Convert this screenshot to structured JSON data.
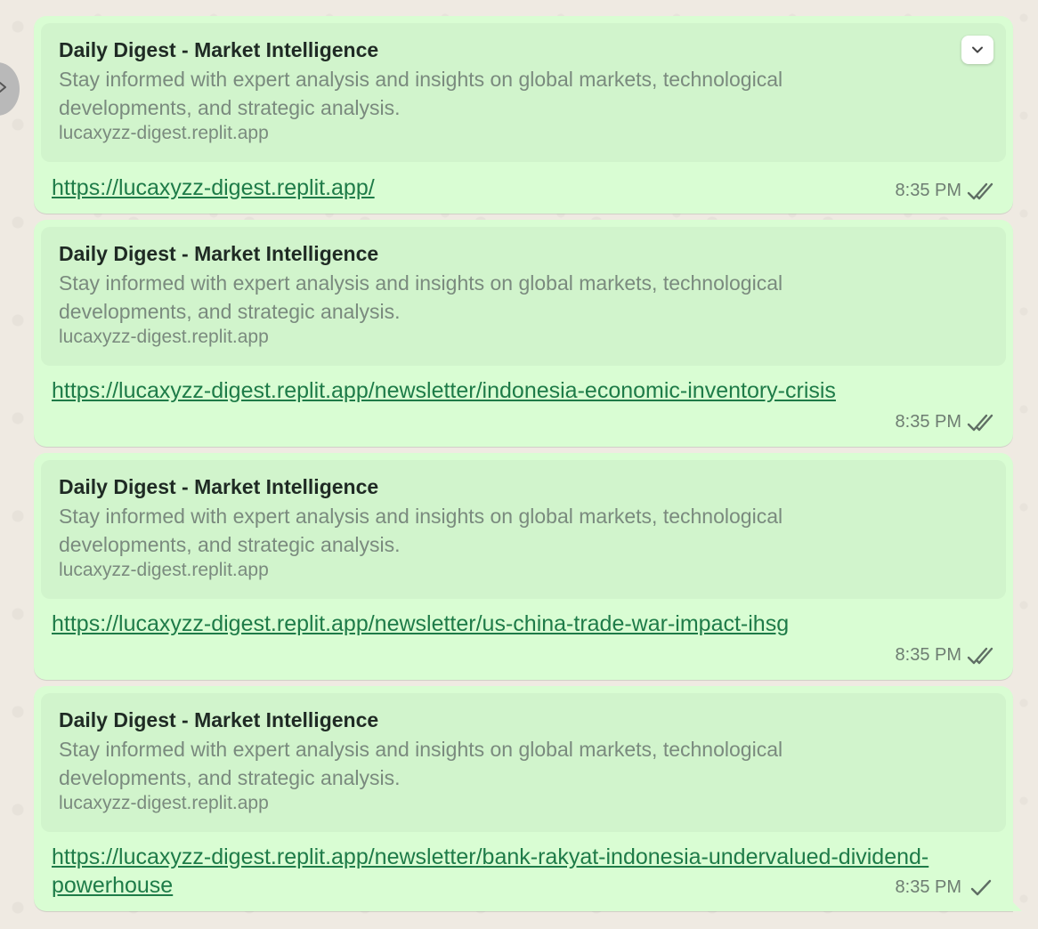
{
  "messages": [
    {
      "preview": {
        "title": "Daily Digest - Market Intelligence",
        "description": "Stay informed with expert analysis and insights on global markets, technological developments, and strategic analysis.",
        "domain": "lucaxyzz-digest.replit.app"
      },
      "link": "https://lucaxyzz-digest.replit.app/",
      "time": "8:35 PM",
      "status_icon": "double-check-icon"
    },
    {
      "preview": {
        "title": "Daily Digest - Market Intelligence",
        "description": "Stay informed with expert analysis and insights on global markets, technological developments, and strategic analysis.",
        "domain": "lucaxyzz-digest.replit.app"
      },
      "link": "https://lucaxyzz-digest.replit.app/newsletter/indonesia-economic-inventory-crisis",
      "time": "8:35 PM",
      "status_icon": "double-check-icon"
    },
    {
      "preview": {
        "title": "Daily Digest - Market Intelligence",
        "description": "Stay informed with expert analysis and insights on global markets, technological developments, and strategic analysis.",
        "domain": "lucaxyzz-digest.replit.app"
      },
      "link": "https://lucaxyzz-digest.replit.app/newsletter/us-china-trade-war-impact-ihsg",
      "time": "8:35 PM",
      "status_icon": "double-check-icon"
    },
    {
      "preview": {
        "title": "Daily Digest - Market Intelligence",
        "description": "Stay informed with expert analysis and insights on global markets, technological developments, and strategic analysis.",
        "domain": "lucaxyzz-digest.replit.app"
      },
      "link": "https://lucaxyzz-digest.replit.app/newsletter/bank-rakyat-indonesia-undervalued-dividend-powerhouse",
      "time": "8:35 PM",
      "status_icon": "single-check-icon"
    }
  ],
  "colors": {
    "bubble": "#d9fdd3",
    "preview": "#d1f4cc",
    "link": "#1e7b48",
    "read_tick": "#5f6e64"
  }
}
